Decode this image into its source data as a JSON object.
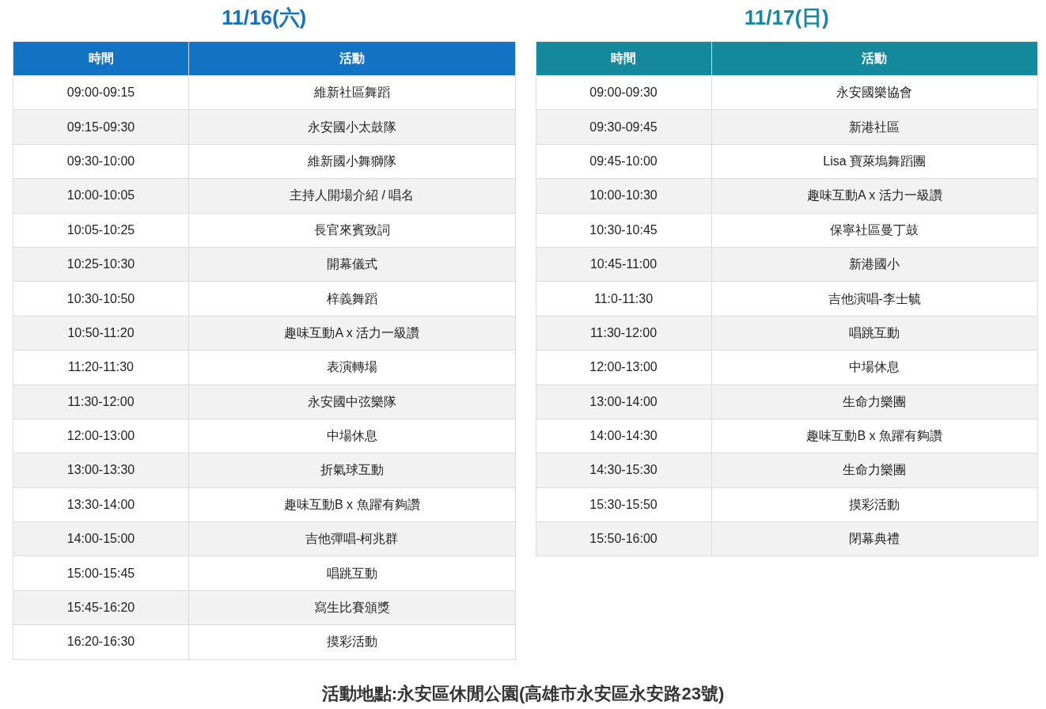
{
  "days": [
    {
      "title": "11/16(六)",
      "color": "#1272c4",
      "columns": [
        "時間",
        "活動"
      ],
      "rows": [
        [
          "09:00-09:15",
          "維新社區舞蹈"
        ],
        [
          "09:15-09:30",
          "永安國小太鼓隊"
        ],
        [
          "09:30-10:00",
          "維新國小舞獅隊"
        ],
        [
          "10:00-10:05",
          "主持人開場介紹 / 唱名"
        ],
        [
          "10:05-10:25",
          "長官來賓致詞"
        ],
        [
          "10:25-10:30",
          "開幕儀式"
        ],
        [
          "10:30-10:50",
          "梓義舞蹈"
        ],
        [
          "10:50-11:20",
          "趣味互動A x 活力一級讚"
        ],
        [
          "11:20-11:30",
          "表演轉場"
        ],
        [
          "11:30-12:00",
          "永安國中弦樂隊"
        ],
        [
          "12:00-13:00",
          "中場休息"
        ],
        [
          "13:00-13:30",
          "折氣球互動"
        ],
        [
          "13:30-14:00",
          "趣味互動B x 魚躍有夠讚"
        ],
        [
          "14:00-15:00",
          "吉他彈唱-柯兆群"
        ],
        [
          "15:00-15:45",
          "唱跳互動"
        ],
        [
          "15:45-16:20",
          "寫生比賽頒獎"
        ],
        [
          "16:20-16:30",
          "摸彩活動"
        ]
      ]
    },
    {
      "title": "11/17(日)",
      "color": "#14889c",
      "columns": [
        "時間",
        "活動"
      ],
      "rows": [
        [
          "09:00-09:30",
          "永安國樂協會"
        ],
        [
          "09:30-09:45",
          "新港社區"
        ],
        [
          "09:45-10:00",
          "Lisa 寶萊塢舞蹈團"
        ],
        [
          "10:00-10:30",
          "趣味互動A x 活力一級讚"
        ],
        [
          "10:30-10:45",
          "保寧社區曼丁鼓"
        ],
        [
          "10:45-11:00",
          "新港國小"
        ],
        [
          "11:0-11:30",
          "吉他演唱-李士毓"
        ],
        [
          "11:30-12:00",
          "唱跳互動"
        ],
        [
          "12:00-13:00",
          "中場休息"
        ],
        [
          "13:00-14:00",
          "生命力樂團"
        ],
        [
          "14:00-14:30",
          "趣味互動B x 魚躍有夠讚"
        ],
        [
          "14:30-15:30",
          "生命力樂團"
        ],
        [
          "15:30-15:50",
          "摸彩活動"
        ],
        [
          "15:50-16:00",
          "閉幕典禮"
        ]
      ]
    }
  ],
  "location": "活動地點:永安區休閒公園(高雄市永安區永安路23號)"
}
